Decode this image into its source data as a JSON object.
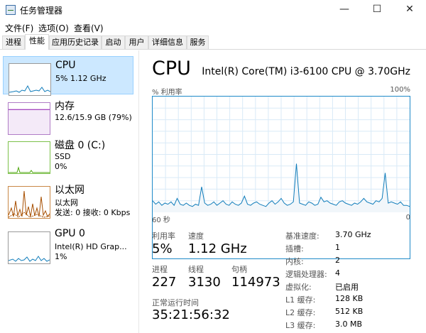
{
  "window": {
    "title": "任务管理器",
    "minimize_glyph": "—",
    "maximize_glyph": "☐",
    "close_glyph": "✕"
  },
  "menu": [
    "文件(F)",
    "选项(O)",
    "查看(V)"
  ],
  "tabs": [
    "进程",
    "性能",
    "应用历史记录",
    "启动",
    "用户",
    "详细信息",
    "服务"
  ],
  "active_tab": "性能",
  "sidebar": {
    "items": [
      {
        "name": "CPU",
        "line1": "5% 1.12 GHz",
        "line2": "",
        "color": "#117dbb"
      },
      {
        "name": "内存",
        "line1": "12.6/15.9 GB (79%)",
        "line2": "",
        "color": "#8b12ae"
      },
      {
        "name": "磁盘 0 (C:)",
        "line1": "SSD",
        "line2": "0%",
        "color": "#4da60c"
      },
      {
        "name": "以太网",
        "line1": "以太网",
        "line2": "发送: 0 接收: 0 Kbps",
        "color": "#a74f01"
      },
      {
        "name": "GPU 0",
        "line1": "Intel(R) HD Grap...",
        "line2": "1%",
        "color": "#117dbb"
      }
    ],
    "memory_usage_fraction": 0.79
  },
  "main": {
    "title": "CPU",
    "model": "Intel(R) Core(TM) i3-6100 CPU @ 3.70GHz",
    "util_label": "% 利用率",
    "util_max": "100%",
    "time_left": "60 秒",
    "time_right": "0",
    "stats": {
      "utilization_label": "利用率",
      "utilization_value": "5%",
      "speed_label": "速度",
      "speed_value": "1.12 GHz",
      "processes_label": "进程",
      "processes_value": "227",
      "threads_label": "线程",
      "threads_value": "3130",
      "handles_label": "句柄",
      "handles_value": "114973",
      "uptime_label": "正常运行时间",
      "uptime_value": "35:21:56:32"
    },
    "specs": [
      {
        "key": "基准速度:",
        "value": "3.70 GHz"
      },
      {
        "key": "插槽:",
        "value": "1"
      },
      {
        "key": "内核:",
        "value": "2"
      },
      {
        "key": "逻辑处理器:",
        "value": "4"
      },
      {
        "key": "虚拟化:",
        "value": "已启用"
      },
      {
        "key": "L1 缓存:",
        "value": "128 KB"
      },
      {
        "key": "L2 缓存:",
        "value": "512 KB"
      },
      {
        "key": "L3 缓存:",
        "value": "3.0 MB"
      }
    ],
    "accent_color": "#117dbb",
    "cpu_history_percent": [
      10,
      7,
      9,
      6,
      8,
      7,
      9,
      6,
      12,
      7,
      6,
      8,
      6,
      5,
      7,
      6,
      22,
      8,
      6,
      7,
      9,
      6,
      8,
      10,
      7,
      6,
      9,
      7,
      6,
      8,
      14,
      7,
      6,
      8,
      9,
      7,
      6,
      5,
      8,
      10,
      7,
      9,
      12,
      8,
      6,
      7,
      9,
      42,
      8,
      7,
      6,
      9,
      8,
      6,
      7,
      13,
      9,
      10,
      8,
      7,
      6,
      9,
      10,
      8,
      7,
      6,
      8,
      7,
      9,
      12,
      9,
      8,
      7,
      10,
      9,
      12,
      34,
      8,
      9,
      8,
      7,
      9,
      6,
      6,
      5
    ]
  }
}
